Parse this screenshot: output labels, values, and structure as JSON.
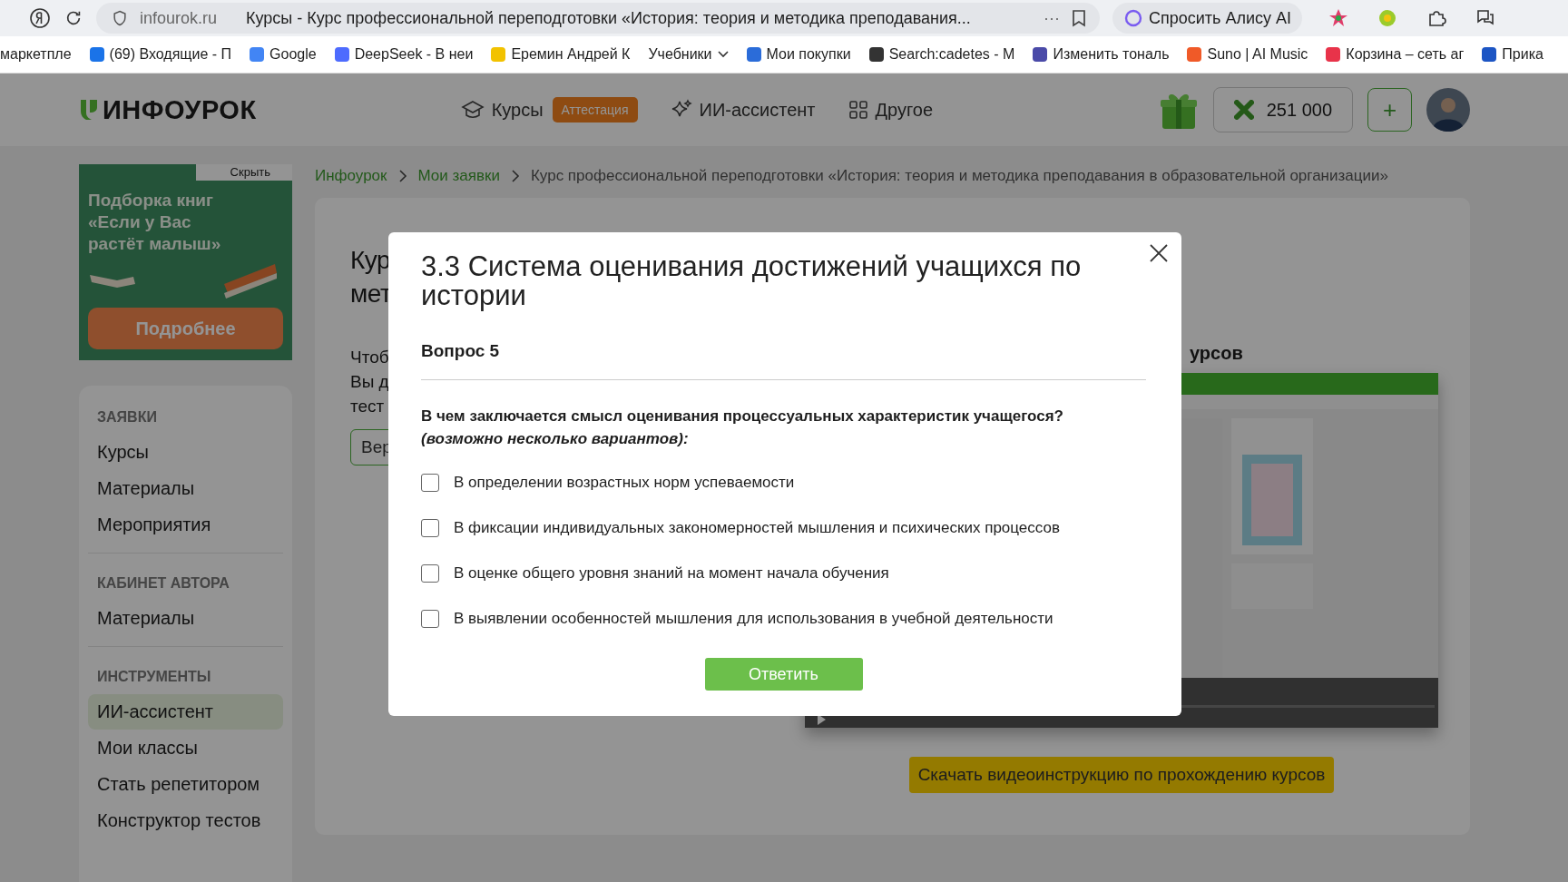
{
  "browser": {
    "address": "infourok.ru",
    "tab_title": "Курсы - Курс профессиональной переподготовки «История: теория и методика преподавания...",
    "more": "···",
    "alice": "Спросить Алису AI"
  },
  "bookmarks": [
    {
      "label": "маркетпле"
    },
    {
      "label": "(69) Входящие - П",
      "color": "#1a73e8"
    },
    {
      "label": "Google",
      "color": "#4285f4"
    },
    {
      "label": "DeepSeek - В неи",
      "color": "#4d6bfe"
    },
    {
      "label": "Еремин Андрей К",
      "color": "#f2c200"
    },
    {
      "label": "Учебники",
      "kind": "folder"
    },
    {
      "label": "Мои покупки",
      "color": "#2b6cd9"
    },
    {
      "label": "Search:cadetes - M",
      "color": "#333333"
    },
    {
      "label": "Изменить тональ",
      "color": "#4a4aa8"
    },
    {
      "label": "Suno | AI Music",
      "color": "#f05a28"
    },
    {
      "label": "Корзина – сеть аг",
      "color": "#e8334a"
    },
    {
      "label": "Прика",
      "color": "#1c55c4"
    }
  ],
  "header": {
    "logo": "ИНФОУРОК",
    "nav": [
      {
        "kind": "cap",
        "label": "Курсы",
        "badge": "Аттестация"
      },
      {
        "kind": "sparkle",
        "label": "ИИ-ассистент"
      },
      {
        "kind": "grid",
        "label": "Другое"
      }
    ],
    "balance": "251 000",
    "add": "+"
  },
  "ad": {
    "hide": "Скрыть",
    "text": "Подборка книг «Если у Вас растёт малыш»",
    "button": "Подробнее"
  },
  "sidebar": [
    {
      "title": "ЗАЯВКИ",
      "items": [
        {
          "label": "Курсы",
          "selected": false
        },
        {
          "label": "Материалы",
          "selected": false
        },
        {
          "label": "Мероприятия",
          "selected": false
        }
      ]
    },
    {
      "title": "КАБИНЕТ АВТОРА",
      "items": [
        {
          "label": "Материалы",
          "selected": false
        }
      ]
    },
    {
      "title": "ИНСТРУМЕНТЫ",
      "items": [
        {
          "label": "ИИ-ассистент",
          "selected": true
        },
        {
          "label": "Мои классы",
          "selected": false
        },
        {
          "label": "Стать репетитором",
          "selected": false
        },
        {
          "label": "Конструктор тестов",
          "selected": false
        }
      ]
    }
  ],
  "breadcrumb": [
    "Инфоурок",
    "Мои заявки",
    "Курс профессиональной переподготовки «История: теория и методика преподавания в образовательной организации»"
  ],
  "content": {
    "title_lines": [
      "Кур",
      "мет"
    ],
    "text_lines": [
      "Чтоб",
      "Вы д",
      "тест"
    ],
    "button": "Вер",
    "video_heading": "урсов",
    "download_button": "Скачать видеоинструкцию по прохождению курсов"
  },
  "modal": {
    "title": "3.3 Система оценивания достижений учащихся по истории",
    "question_number": "Вопрос 5",
    "question": "В чем заключается смысл оценивания процессуальных характеристик учащегося?",
    "hint": "(возможно несколько вариантов):",
    "options": [
      {
        "label": "В определении возрастных норм успеваемости",
        "checked": false
      },
      {
        "label": "В фиксации индивидуальных закономерностей мышления и психических процессов",
        "checked": false
      },
      {
        "label": "В оценке общего уровня знаний на момент начала обучения",
        "checked": false
      },
      {
        "label": "В выявлении особенностей мышления для использования в учебной деятельности",
        "checked": false
      }
    ],
    "submit": "Ответить"
  }
}
